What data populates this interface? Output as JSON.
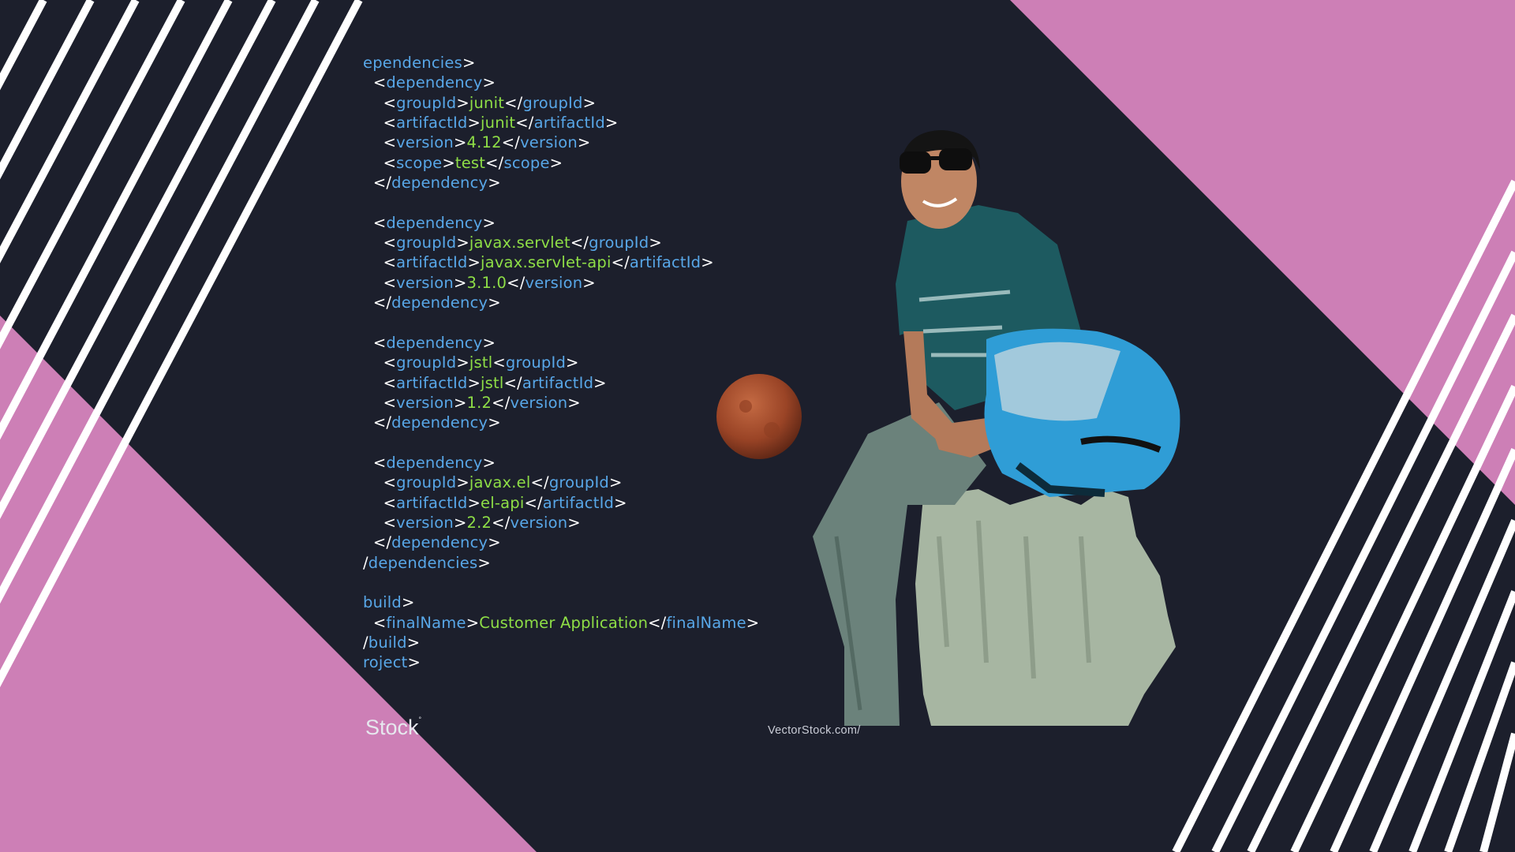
{
  "code_lines": [
    [
      [
        "tag",
        "ependencies"
      ],
      [
        "br",
        ">"
      ]
    ],
    [
      [
        "sp",
        "  "
      ],
      [
        "br",
        "<"
      ],
      [
        "tag",
        "dependency"
      ],
      [
        "br",
        ">"
      ]
    ],
    [
      [
        "sp",
        "    "
      ],
      [
        "br",
        "<"
      ],
      [
        "tag",
        "groupId"
      ],
      [
        "br",
        ">"
      ],
      [
        "val",
        "junit"
      ],
      [
        "br",
        "</"
      ],
      [
        "tag",
        "groupId"
      ],
      [
        "br",
        ">"
      ]
    ],
    [
      [
        "sp",
        "    "
      ],
      [
        "br",
        "<"
      ],
      [
        "tag",
        "artifactId"
      ],
      [
        "br",
        ">"
      ],
      [
        "val",
        "junit"
      ],
      [
        "br",
        "</"
      ],
      [
        "tag",
        "artifactId"
      ],
      [
        "br",
        ">"
      ]
    ],
    [
      [
        "sp",
        "    "
      ],
      [
        "br",
        "<"
      ],
      [
        "tag",
        "version"
      ],
      [
        "br",
        ">"
      ],
      [
        "val",
        "4.12"
      ],
      [
        "br",
        "</"
      ],
      [
        "tag",
        "version"
      ],
      [
        "br",
        ">"
      ]
    ],
    [
      [
        "sp",
        "    "
      ],
      [
        "br",
        "<"
      ],
      [
        "tag",
        "scope"
      ],
      [
        "br",
        ">"
      ],
      [
        "val",
        "test"
      ],
      [
        "br",
        "</"
      ],
      [
        "tag",
        "scope"
      ],
      [
        "br",
        ">"
      ]
    ],
    [
      [
        "sp",
        "  "
      ],
      [
        "br",
        "</"
      ],
      [
        "tag",
        "dependency"
      ],
      [
        "br",
        ">"
      ]
    ],
    [],
    [
      [
        "sp",
        "  "
      ],
      [
        "br",
        "<"
      ],
      [
        "tag",
        "dependency"
      ],
      [
        "br",
        ">"
      ]
    ],
    [
      [
        "sp",
        "    "
      ],
      [
        "br",
        "<"
      ],
      [
        "tag",
        "groupId"
      ],
      [
        "br",
        ">"
      ],
      [
        "val",
        "javax.servlet"
      ],
      [
        "br",
        "</"
      ],
      [
        "tag",
        "groupId"
      ],
      [
        "br",
        ">"
      ]
    ],
    [
      [
        "sp",
        "    "
      ],
      [
        "br",
        "<"
      ],
      [
        "tag",
        "artifactId"
      ],
      [
        "br",
        ">"
      ],
      [
        "val",
        "javax.servlet-api"
      ],
      [
        "br",
        "</"
      ],
      [
        "tag",
        "artifactId"
      ],
      [
        "br",
        ">"
      ]
    ],
    [
      [
        "sp",
        "    "
      ],
      [
        "br",
        "<"
      ],
      [
        "tag",
        "version"
      ],
      [
        "br",
        ">"
      ],
      [
        "val",
        "3.1.0"
      ],
      [
        "br",
        "</"
      ],
      [
        "tag",
        "version"
      ],
      [
        "br",
        ">"
      ]
    ],
    [
      [
        "sp",
        "  "
      ],
      [
        "br",
        "</"
      ],
      [
        "tag",
        "dependency"
      ],
      [
        "br",
        ">"
      ]
    ],
    [],
    [
      [
        "sp",
        "  "
      ],
      [
        "br",
        "<"
      ],
      [
        "tag",
        "dependency"
      ],
      [
        "br",
        ">"
      ]
    ],
    [
      [
        "sp",
        "    "
      ],
      [
        "br",
        "<"
      ],
      [
        "tag",
        "groupId"
      ],
      [
        "br",
        ">"
      ],
      [
        "val",
        "jstl"
      ],
      [
        "br",
        "<"
      ],
      [
        "tag",
        "groupId"
      ],
      [
        "br",
        ">"
      ]
    ],
    [
      [
        "sp",
        "    "
      ],
      [
        "br",
        "<"
      ],
      [
        "tag",
        "artifactId"
      ],
      [
        "br",
        ">"
      ],
      [
        "val",
        "jstl"
      ],
      [
        "br",
        "</"
      ],
      [
        "tag",
        "artifactId"
      ],
      [
        "br",
        ">"
      ]
    ],
    [
      [
        "sp",
        "    "
      ],
      [
        "br",
        "<"
      ],
      [
        "tag",
        "version"
      ],
      [
        "br",
        ">"
      ],
      [
        "val",
        "1.2"
      ],
      [
        "br",
        "</"
      ],
      [
        "tag",
        "version"
      ],
      [
        "br",
        ">"
      ]
    ],
    [
      [
        "sp",
        "  "
      ],
      [
        "br",
        "</"
      ],
      [
        "tag",
        "dependency"
      ],
      [
        "br",
        ">"
      ]
    ],
    [],
    [
      [
        "sp",
        "  "
      ],
      [
        "br",
        "<"
      ],
      [
        "tag",
        "dependency"
      ],
      [
        "br",
        ">"
      ]
    ],
    [
      [
        "sp",
        "    "
      ],
      [
        "br",
        "<"
      ],
      [
        "tag",
        "groupId"
      ],
      [
        "br",
        ">"
      ],
      [
        "val",
        "javax.el"
      ],
      [
        "br",
        "</"
      ],
      [
        "tag",
        "groupId"
      ],
      [
        "br",
        ">"
      ]
    ],
    [
      [
        "sp",
        "    "
      ],
      [
        "br",
        "<"
      ],
      [
        "tag",
        "artifactId"
      ],
      [
        "br",
        ">"
      ],
      [
        "val",
        "el-api"
      ],
      [
        "br",
        "</"
      ],
      [
        "tag",
        "artifactId"
      ],
      [
        "br",
        ">"
      ]
    ],
    [
      [
        "sp",
        "    "
      ],
      [
        "br",
        "<"
      ],
      [
        "tag",
        "version"
      ],
      [
        "br",
        ">"
      ],
      [
        "val",
        "2.2"
      ],
      [
        "br",
        "</"
      ],
      [
        "tag",
        "version"
      ],
      [
        "br",
        ">"
      ]
    ],
    [
      [
        "sp",
        "  "
      ],
      [
        "br",
        "</"
      ],
      [
        "tag",
        "dependency"
      ],
      [
        "br",
        ">"
      ]
    ],
    [
      [
        "br",
        "/"
      ],
      [
        "tag",
        "dependencies"
      ],
      [
        "br",
        ">"
      ]
    ],
    [],
    [
      [
        "tag",
        "build"
      ],
      [
        "br",
        ">"
      ]
    ],
    [
      [
        "sp",
        "  "
      ],
      [
        "br",
        "<"
      ],
      [
        "tag",
        "finalName"
      ],
      [
        "br",
        ">"
      ],
      [
        "val",
        "Customer Application"
      ],
      [
        "br",
        "</"
      ],
      [
        "tag",
        "finalName"
      ],
      [
        "br",
        ">"
      ]
    ],
    [
      [
        "br",
        "/"
      ],
      [
        "tag",
        "build"
      ],
      [
        "br",
        ">"
      ]
    ],
    [
      [
        "tag",
        "roject"
      ],
      [
        "br",
        ">"
      ]
    ]
  ],
  "watermark_left": "Stock",
  "watermark_left_sup": "°",
  "watermark_right": "VectorStock.com/",
  "colors": {
    "background": "#1c1f2c",
    "pink": "#cd7fb6",
    "stripe": "#ffffff",
    "tag": "#58a7e8",
    "value": "#8ede46",
    "shirt": "#1d5a60",
    "helmet": "#2f9dd6",
    "moon": "#a34b2a",
    "rock": "#a7b6a2"
  }
}
